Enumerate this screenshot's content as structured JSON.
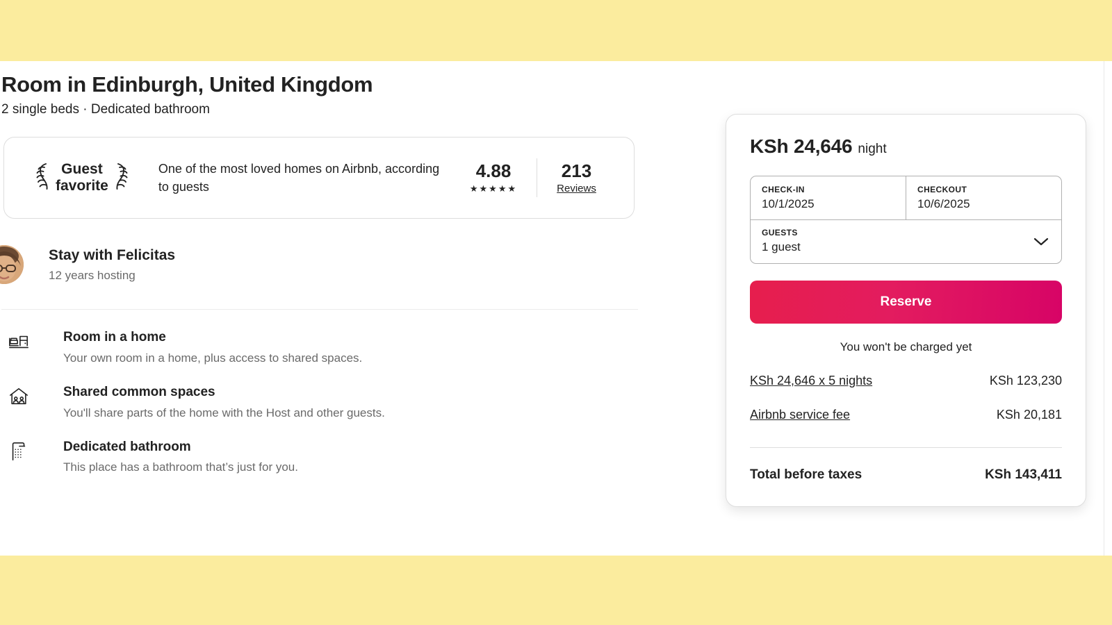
{
  "listing": {
    "title": "Room in Edinburgh, United Kingdom",
    "subtitle": "2 single beds · Dedicated bathroom"
  },
  "guest_favorite": {
    "badge_label": "Guest\nfavorite",
    "description": "One of the most loved homes on Airbnb, according to guests",
    "rating": "4.88",
    "stars": "★★★★★",
    "reviews_count": "213",
    "reviews_label": "Reviews",
    "left_laurel_icon": "laurel-wreath-icon",
    "right_laurel_icon": "laurel-wreath-icon"
  },
  "host": {
    "name": "Stay with Felicitas",
    "tenure": "12 years hosting",
    "avatar_icon": "host-avatar"
  },
  "features": [
    {
      "icon": "bed-room-icon",
      "title": "Room in a home",
      "description": "Your own room in a home, plus access to shared spaces."
    },
    {
      "icon": "shared-house-icon",
      "title": "Shared common spaces",
      "description": "You'll share parts of the home with the Host and other guests."
    },
    {
      "icon": "shower-bathroom-icon",
      "title": "Dedicated bathroom",
      "description": "This place has a bathroom that’s just for you."
    }
  ],
  "booking": {
    "price_amount": "KSh 24,646",
    "price_unit": "night",
    "checkin_label": "CHECK-IN",
    "checkin_value": "10/1/2025",
    "checkout_label": "CHECKOUT",
    "checkout_value": "10/6/2025",
    "guests_label": "GUESTS",
    "guests_value": "1 guest",
    "guests_chevron_icon": "chevron-down-icon",
    "reserve_label": "Reserve",
    "no_charge_note": "You won't be charged yet",
    "fees": [
      {
        "label": "KSh 24,646 x 5 nights",
        "value": "KSh 123,230"
      },
      {
        "label": "Airbnb service fee",
        "value": "KSh 20,181"
      }
    ],
    "total_label": "Total before taxes",
    "total_value": "KSh 143,411"
  },
  "colors": {
    "page_band": "#FBEC9E",
    "reserve_gradient_start": "#E61E4D",
    "reserve_gradient_end": "#D70466",
    "text_primary": "#222222",
    "text_secondary": "#6A6A6A"
  }
}
